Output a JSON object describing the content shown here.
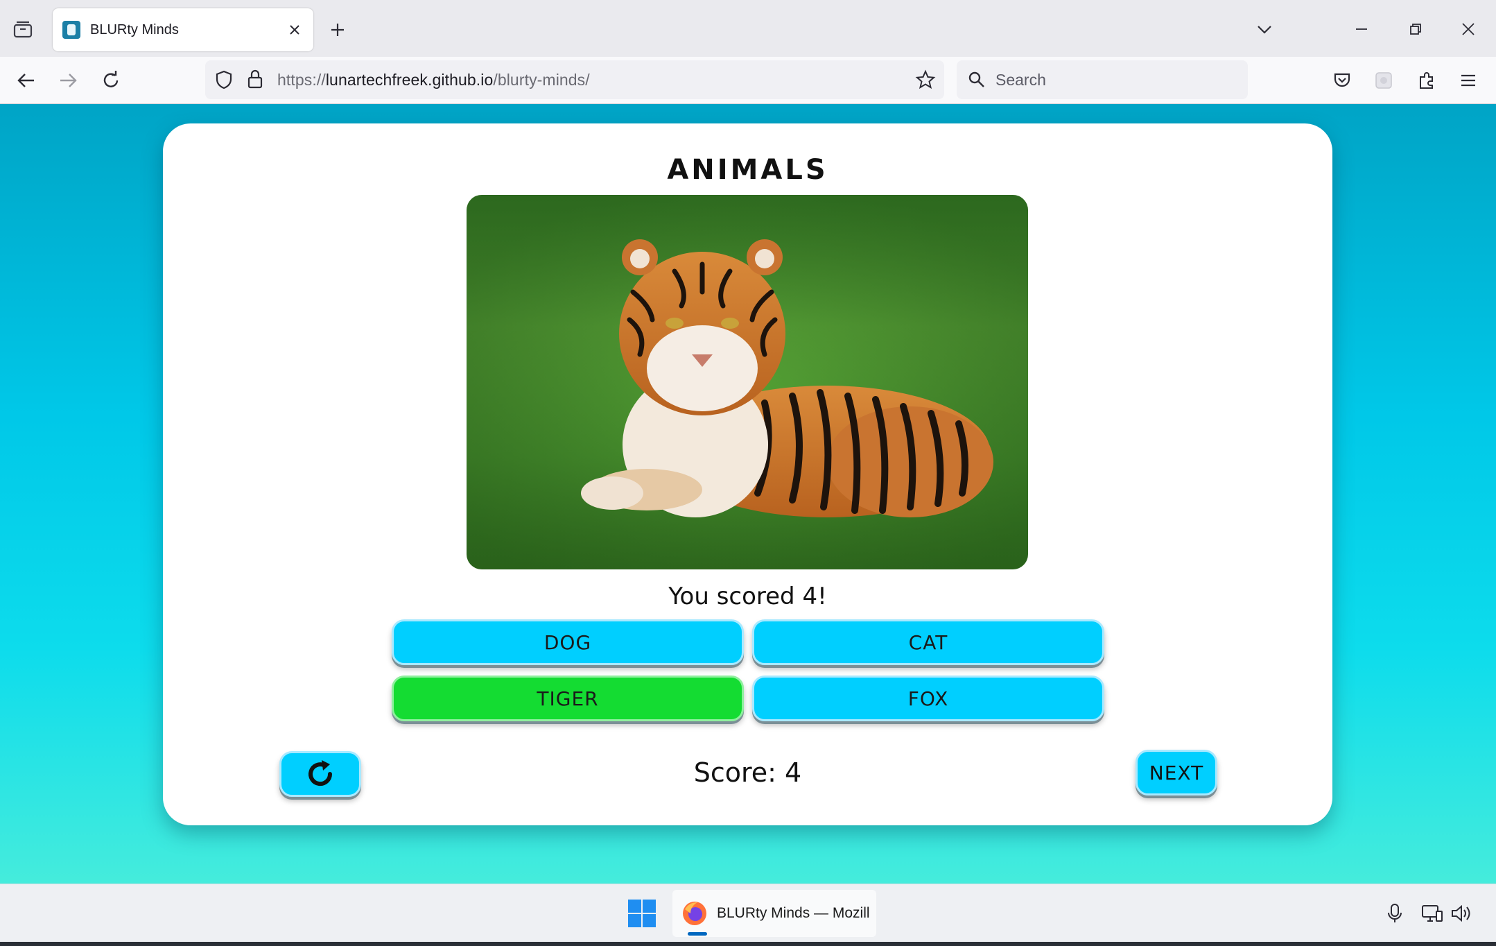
{
  "browser": {
    "tab_title": "BLURty Minds",
    "url_base": "https://",
    "url_domain": "lunartechfreek.github.io",
    "url_path": "/blurty-minds/",
    "search_placeholder": "Search"
  },
  "quiz": {
    "category": "ANIMALS",
    "image_subject": "tiger lying on grass",
    "result_text": "You scored 4!",
    "answers": [
      {
        "label": "DOG",
        "state": "default"
      },
      {
        "label": "CAT",
        "state": "default"
      },
      {
        "label": "TIGER",
        "state": "correct"
      },
      {
        "label": "FOX",
        "state": "default"
      }
    ],
    "score_text": "Score: 4",
    "next_label": "NEXT",
    "colors": {
      "button": "#00cfff",
      "correct": "#14dc32"
    }
  },
  "taskbar": {
    "app_label": "BLURty Minds — Mozill"
  },
  "icons": {
    "restart": "restart-icon",
    "windows": "windows-start-icon",
    "firefox": "firefox-icon"
  }
}
